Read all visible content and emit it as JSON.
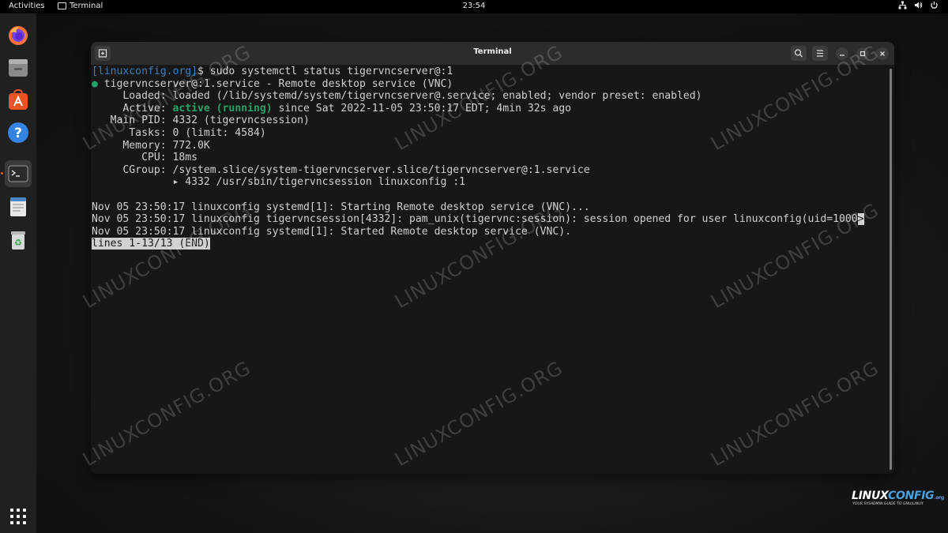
{
  "topbar": {
    "activities": "Activities",
    "app_name": "Terminal",
    "clock": "23:54"
  },
  "dock": {
    "items": [
      {
        "name": "firefox",
        "icon": "firefox-icon"
      },
      {
        "name": "files",
        "icon": "files-icon"
      },
      {
        "name": "software",
        "icon": "software-icon"
      },
      {
        "name": "help",
        "icon": "help-icon"
      },
      {
        "name": "terminal",
        "icon": "terminal-icon",
        "running": true
      },
      {
        "name": "text-editor",
        "icon": "text-editor-icon"
      },
      {
        "name": "trash",
        "icon": "trash-icon"
      }
    ],
    "show_apps_icon": "apps-grid-icon"
  },
  "window": {
    "title": "Terminal",
    "terminal": {
      "prompt": "[linuxconfig.org]",
      "command": "$ sudo systemctl status tigervncserver@:1",
      "lines": {
        "l1_dot": "●",
        "l1": " tigervncserver@:1.service - Remote desktop service (VNC)",
        "l2": "     Loaded: loaded (/lib/systemd/system/tigervncserver@.service; enabled; vendor preset: enabled)",
        "l3_pre": "     Active: ",
        "l3_status": "active (running)",
        "l3_post": " since Sat 2022-11-05 23:50:17 EDT; 4min 32s ago",
        "l4": "   Main PID: 4332 (tigervncsession)",
        "l5": "      Tasks: 0 (limit: 4584)",
        "l6": "     Memory: 772.0K",
        "l7": "        CPU: 18ms",
        "l8": "     CGroup: /system.slice/system-tigervncserver.slice/tigervncserver@:1.service",
        "l9": "             ▸ 4332 /usr/sbin/tigervncsession linuxconfig :1",
        "log1": "Nov 05 23:50:17 linuxconfig systemd[1]: Starting Remote desktop service (VNC)...",
        "log2": "Nov 05 23:50:17 linuxconfig tigervncsession[4332]: pam_unix(tigervnc:session): session opened for user linuxconfig(uid=1000",
        "log2_more": ">",
        "log3": "Nov 05 23:50:17 linuxconfig systemd[1]: Started Remote desktop service (VNC).",
        "pager": "lines 1-13/13 (END)"
      }
    }
  },
  "watermark": "LINUXCONFIG.ORG",
  "brand": {
    "name_a": "LINUX",
    "name_b": "CONFIG",
    "tld": ".org",
    "tagline": "YOUR SYSADMIN GUIDE TO GNU/LINUX"
  },
  "colors": {
    "prompt": "#3b7fbe",
    "active": "#26a269",
    "terminal_bg": "#171717",
    "titlebar_bg": "#2c2c2c"
  }
}
